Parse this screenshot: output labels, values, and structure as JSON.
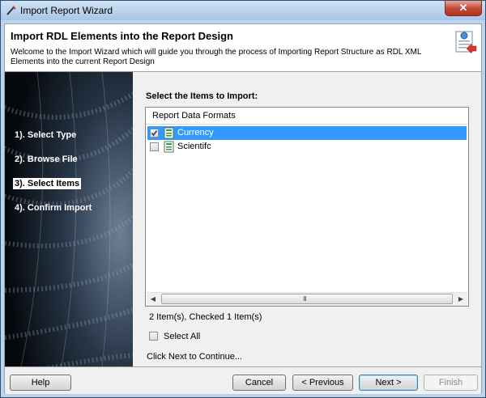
{
  "window": {
    "title": "Import Report Wizard",
    "close_glyph": "✕"
  },
  "header": {
    "title": "Import RDL Elements into the Report Design",
    "description": "Welcome to the Import Wizard which will guide you through the process of Importing Report Structure as RDL XML Elements into the current Report Design",
    "icon": "report-import-icon"
  },
  "steps": [
    {
      "label": "1). Select Type",
      "active": false
    },
    {
      "label": "2). Browse File",
      "active": false
    },
    {
      "label": "3). Select Items",
      "active": true
    },
    {
      "label": "4). Confirm Import",
      "active": false
    }
  ],
  "main": {
    "heading": "Select the Items to Import:",
    "list_header": "Report Data Formats",
    "items": [
      {
        "label": "Currency",
        "checked": true,
        "selected": true
      },
      {
        "label": "Scientifc",
        "checked": false,
        "selected": false
      }
    ],
    "scroll_grip": "III",
    "item_count": "2 Item(s), Checked 1 Item(s)",
    "select_all": "Select All",
    "continue_text": "Click Next to Continue..."
  },
  "buttons": {
    "help": "Help",
    "cancel": "Cancel",
    "previous": "< Previous",
    "next": "Next >",
    "finish": "Finish"
  },
  "colors": {
    "selection": "#3399ff",
    "sidebar_bg": "#0a1522",
    "title_bar": "#bdd4ec"
  }
}
